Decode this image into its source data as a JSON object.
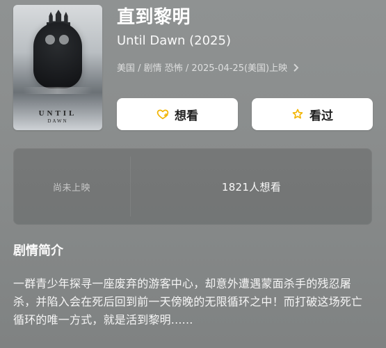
{
  "movie": {
    "title_cn": "直到黎明",
    "title_orig": "Until Dawn (2025)",
    "meta": "美国 / 剧情 恐怖 / 2025-04-25(美国)上映",
    "poster": {
      "title": "UNTIL",
      "subtitle": "DAWN"
    }
  },
  "actions": {
    "want_label": "想看",
    "watched_label": "看过",
    "icons": {
      "want": "heart-plus-icon",
      "watched": "star-icon"
    },
    "colors": {
      "icon_yellow": "#f2b400"
    }
  },
  "stats": {
    "left_label": "尚未上映",
    "right_label": "1821人想看"
  },
  "synopsis": {
    "heading": "剧情简介",
    "text": "一群青少年探寻一座废弃的游客中心，却意外遭遇蒙面杀手的残忍屠杀，并陷入会在死后回到前一天傍晚的无限循环之中！而打破这场死亡循环的唯一方式，就是活到黎明......"
  }
}
